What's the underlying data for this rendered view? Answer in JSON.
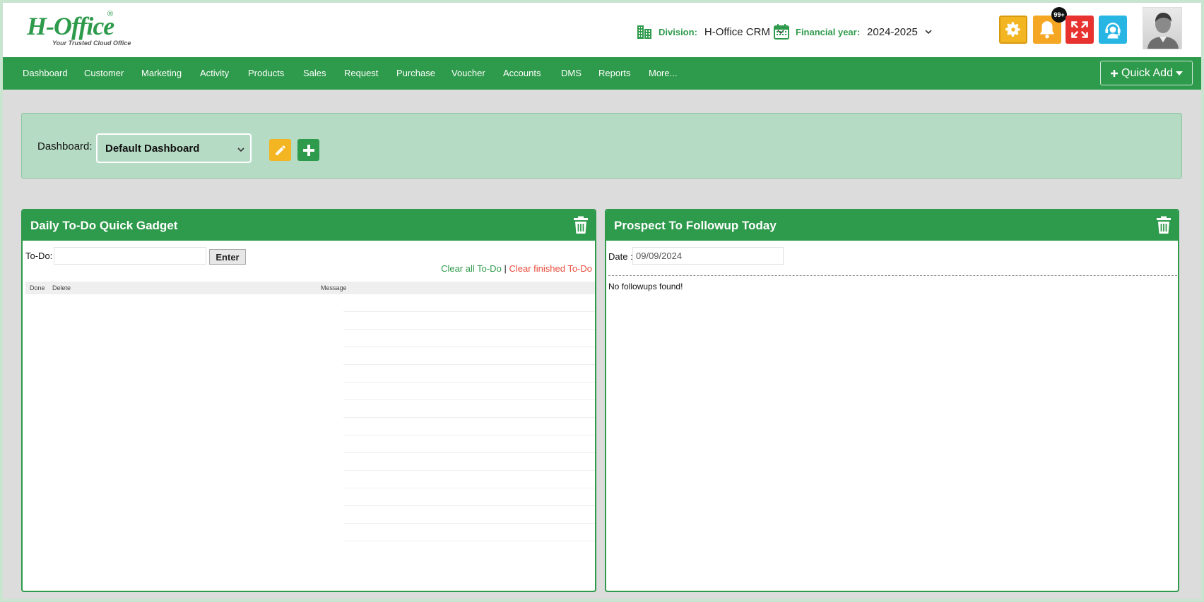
{
  "header": {
    "logo": {
      "main": "H-Office",
      "registered": "®",
      "tagline": "Your Trusted Cloud Office"
    },
    "division": {
      "label": "Division:",
      "value": "H-Office CRM"
    },
    "financial_year": {
      "label": "Financial year:",
      "value": "2024-2025"
    },
    "notifications_badge": "99+",
    "icons": [
      "settings-gear-icon",
      "bell-icon",
      "fullscreen-icon",
      "support-agent-icon",
      "user-avatar"
    ]
  },
  "nav": {
    "items": [
      "Dashboard",
      "Customer",
      "Marketing",
      "Activity",
      "Products",
      "Sales",
      "Request",
      "Purchase",
      "Voucher",
      "Accounts",
      "DMS",
      "Reports",
      "More..."
    ],
    "quick_add": "Quick Add"
  },
  "dashboard": {
    "label": "Dashboard:",
    "selected": "Default Dashboard"
  },
  "todo_gadget": {
    "title": "Daily To-Do Quick Gadget",
    "todo_label": "To-Do:",
    "todo_value": "",
    "enter_button": "Enter",
    "clear_all": "Clear all To-Do",
    "separator": "|",
    "clear_finished": "Clear finished To-Do",
    "columns": [
      "Done",
      "Delete",
      "Message"
    ],
    "rows": []
  },
  "followup_gadget": {
    "title": "Prospect To Followup Today",
    "date_label": "Date :",
    "date_value": "09/09/2024",
    "empty_message": "No followups found!"
  },
  "colors": {
    "brand_green": "#2e9a4b",
    "bar_green": "#b6dbc4",
    "warning": "#f3b521",
    "danger": "#e8322f",
    "info": "#27b6e3"
  }
}
